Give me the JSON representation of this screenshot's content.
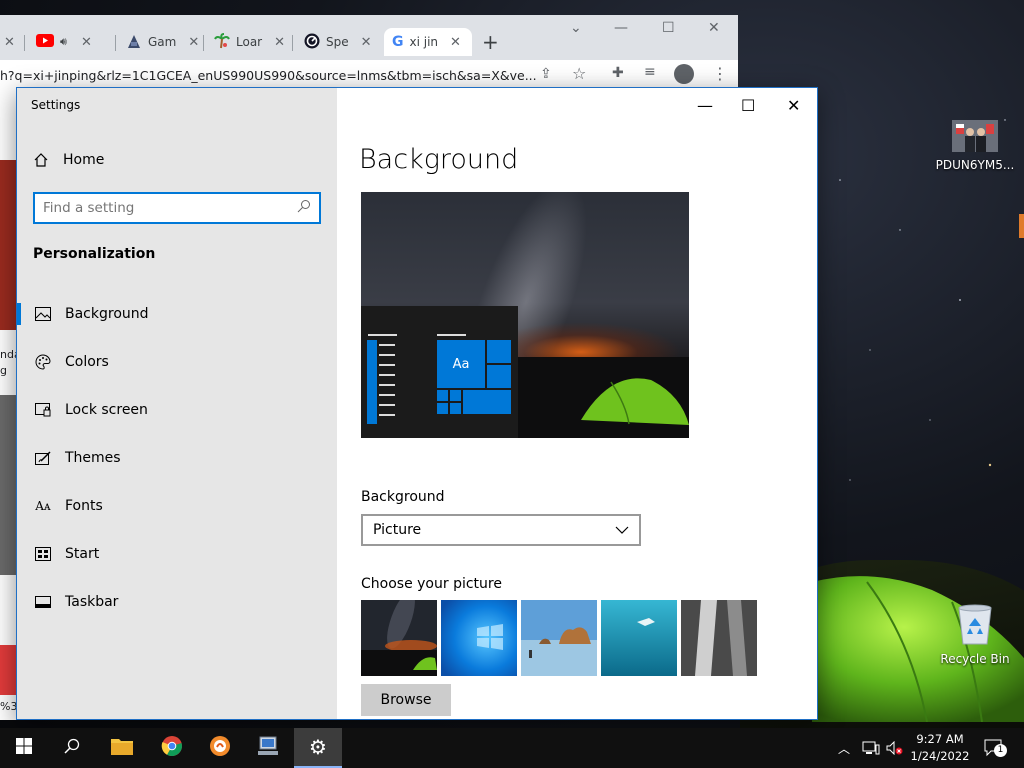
{
  "desktop": {
    "icons": [
      {
        "label": "PDUN6YM5..."
      },
      {
        "label": "Recycle Bin"
      }
    ]
  },
  "chrome": {
    "tabs": [
      {
        "label": "Gam"
      },
      {
        "label": "Loar"
      },
      {
        "label": "Spe"
      },
      {
        "label": "xi jin"
      }
    ],
    "url": "h?q=xi+jinping&rlz=1C1GCEA_enUS990US990&source=lnms&tbm=isch&sa=X&ve...",
    "left_fragments": [
      "nda",
      "g",
      "%3"
    ]
  },
  "settings": {
    "window_title": "Settings",
    "home_label": "Home",
    "search_placeholder": "Find a setting",
    "section_heading": "Personalization",
    "nav_items": [
      {
        "label": "Background",
        "icon": "picture-icon"
      },
      {
        "label": "Colors",
        "icon": "palette-icon"
      },
      {
        "label": "Lock screen",
        "icon": "lock-screen-icon"
      },
      {
        "label": "Themes",
        "icon": "themes-icon"
      },
      {
        "label": "Fonts",
        "icon": "fonts-icon"
      },
      {
        "label": "Start",
        "icon": "start-icon"
      },
      {
        "label": "Taskbar",
        "icon": "taskbar-icon"
      }
    ],
    "selected_nav": "Background",
    "page_title": "Background",
    "preview_tile_text": "Aa",
    "background_label": "Background",
    "background_value": "Picture",
    "choose_picture_label": "Choose your picture",
    "browse_label": "Browse"
  },
  "taskbar": {
    "time": "9:27 AM",
    "date": "1/24/2022",
    "notification_count": "1"
  },
  "colors": {
    "accent": "#0078d7",
    "nav_bg": "#e6e6e6",
    "taskbar_bg": "#101010"
  }
}
